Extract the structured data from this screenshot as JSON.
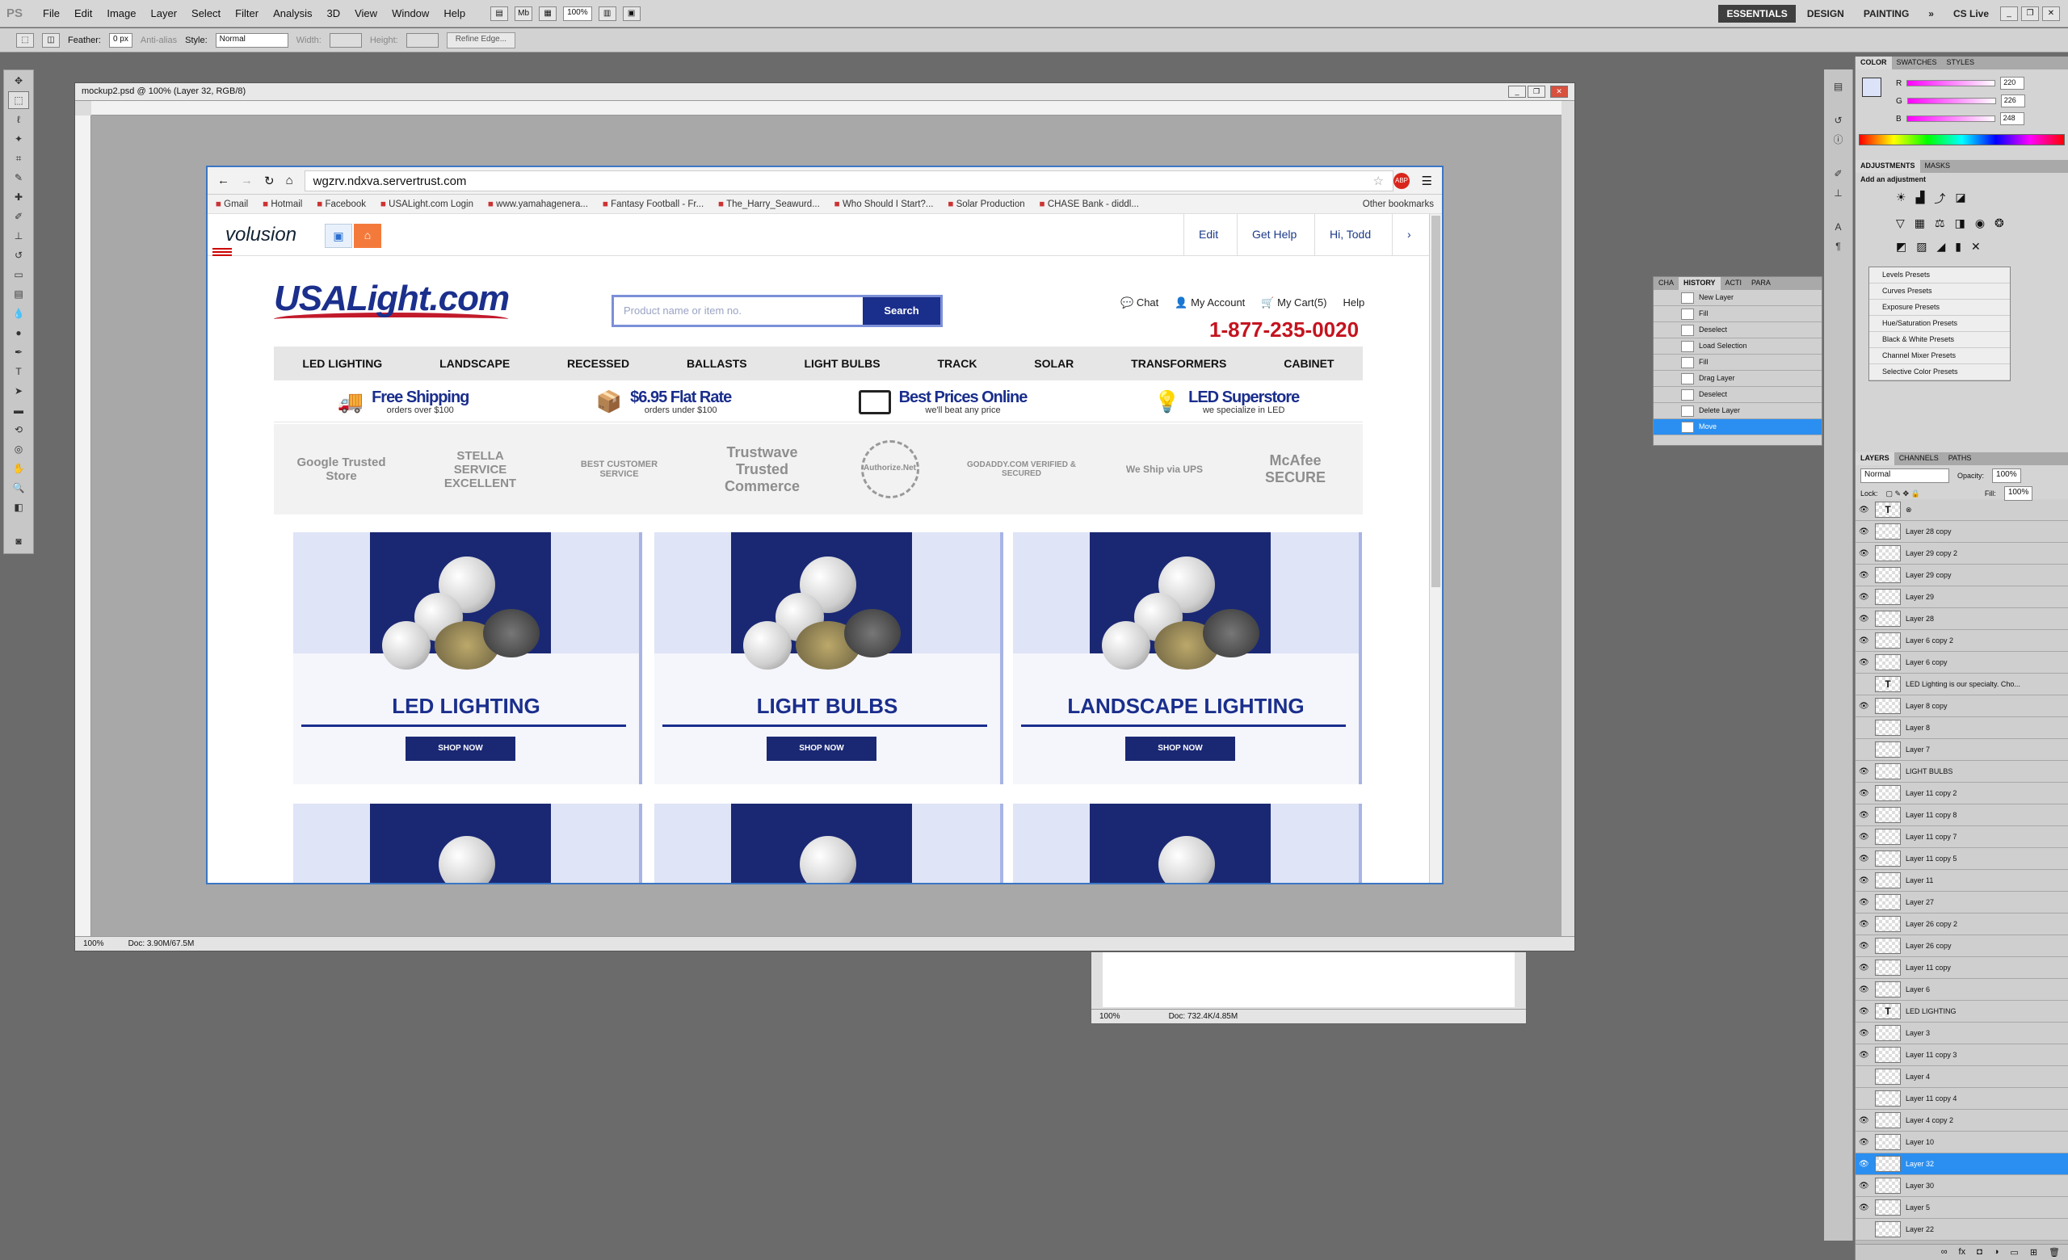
{
  "app": {
    "logo": "PS",
    "menu": [
      "File",
      "Edit",
      "Image",
      "Layer",
      "Select",
      "Filter",
      "Analysis",
      "3D",
      "View",
      "Window",
      "Help"
    ],
    "toolbar": {
      "mb": "Mb",
      "zoom": "100%"
    },
    "workspaces": [
      "ESSENTIALS",
      "DESIGN",
      "PAINTING"
    ],
    "more": "»",
    "cslive": "CS Live"
  },
  "options": {
    "feather_label": "Feather:",
    "feather_value": "0 px",
    "antialias": "Anti-alias",
    "style_label": "Style:",
    "style_value": "Normal",
    "width_label": "Width:",
    "height_label": "Height:",
    "refine": "Refine Edge..."
  },
  "document": {
    "title": "mockup2.psd @ 100% (Layer 32, RGB/8)",
    "zoom": "100%",
    "doc_size": "Doc: 3.90M/67.5M"
  },
  "document2": {
    "zoom": "100%",
    "doc_size": "Doc: 732.4K/4.85M"
  },
  "browser": {
    "url": "wgzrv.ndxva.servertrust.com",
    "bookmarks": [
      "Gmail",
      "Hotmail",
      "Facebook",
      "USALight.com Login",
      "www.yamahagenera...",
      "Fantasy Football - Fr...",
      "The_Harry_Seawurd...",
      "Who Should I Start?...",
      "Solar Production",
      "CHASE Bank - diddl..."
    ],
    "other_bookmarks": "Other bookmarks",
    "volusion": {
      "logo": "volusion",
      "nav": [
        "Edit",
        "Get Help",
        "Hi, Todd"
      ]
    }
  },
  "site": {
    "logo": "USALight.com",
    "search_placeholder": "Product name or item no.",
    "search_button": "Search",
    "links": [
      "Chat",
      "My Account",
      "My Cart(5)",
      "Help"
    ],
    "phone": "1-877-235-0020",
    "categories": [
      "LED LIGHTING",
      "LANDSCAPE",
      "RECESSED",
      "BALLASTS",
      "LIGHT BULBS",
      "TRACK",
      "SOLAR",
      "TRANSFORMERS",
      "CABINET"
    ],
    "perks": [
      {
        "title": "Free Shipping",
        "sub": "orders over $100"
      },
      {
        "title": "$6.95 Flat Rate",
        "sub": "orders under $100"
      },
      {
        "title": "Best Prices Online",
        "sub": "we'll beat any price"
      },
      {
        "title": "LED Superstore",
        "sub": "we specialize in LED"
      }
    ],
    "trust": [
      "Google Trusted Store",
      "STELLA SERVICE EXCELLENT",
      "BEST CUSTOMER SERVICE",
      "Trustwave Trusted Commerce",
      "Authorize.Net",
      "GODADDY.COM VERIFIED & SECURED",
      "We Ship via UPS",
      "McAfee SECURE"
    ],
    "cards": [
      {
        "title": "LED LIGHTING",
        "button": "SHOP NOW"
      },
      {
        "title": "LIGHT BULBS",
        "button": "SHOP NOW"
      },
      {
        "title": "LANDSCAPE LIGHTING",
        "button": "SHOP NOW"
      }
    ]
  },
  "panels": {
    "color_tabs": [
      "COLOR",
      "SWATCHES",
      "STYLES"
    ],
    "rgb": [
      {
        "label": "R",
        "value": "220"
      },
      {
        "label": "G",
        "value": "226"
      },
      {
        "label": "B",
        "value": "248"
      }
    ],
    "adj_tabs": [
      "ADJUSTMENTS",
      "MASKS"
    ],
    "adj_title": "Add an adjustment",
    "presets": [
      "Levels Presets",
      "Curves Presets",
      "Exposure Presets",
      "Hue/Saturation Presets",
      "Black & White Presets",
      "Channel Mixer Presets",
      "Selective Color Presets"
    ],
    "history_tabs": [
      "CHA",
      "HISTORY",
      "ACTI",
      "PARA"
    ],
    "history": [
      "New Layer",
      "Fill",
      "Deselect",
      "Load Selection",
      "Fill",
      "Drag Layer",
      "Deselect",
      "Delete Layer",
      "Move"
    ],
    "layer_tabs": [
      "LAYERS",
      "CHANNELS",
      "PATHS"
    ],
    "blend_mode": "Normal",
    "opacity_label": "Opacity:",
    "opacity": "100%",
    "lock_label": "Lock:",
    "fill_label": "Fill:",
    "fill": "100%",
    "layers": [
      "Layer 28 copy",
      "Layer 29 copy 2",
      "Layer 29 copy",
      "Layer 29",
      "Layer 28",
      "Layer 6 copy 2",
      "Layer 6 copy",
      "LED Lighting is our specialty. Cho...",
      "Layer 8 copy",
      "Layer 8",
      "Layer 7",
      "LIGHT BULBS",
      "Layer 11 copy 2",
      "Layer 11 copy 8",
      "Layer 11 copy 7",
      "Layer 11 copy 5",
      "Layer 11",
      "Layer 27",
      "Layer 26 copy 2",
      "Layer 26 copy",
      "Layer 11 copy",
      "Layer 6",
      "LED LIGHTING",
      "Layer 3",
      "Layer 11 copy 3",
      "Layer 4",
      "Layer 11 copy 4",
      "Layer 4 copy 2",
      "Layer 10",
      "Layer 32",
      "Layer 30",
      "Layer 5",
      "Layer 22"
    ],
    "selected_layer": "Layer 32"
  }
}
